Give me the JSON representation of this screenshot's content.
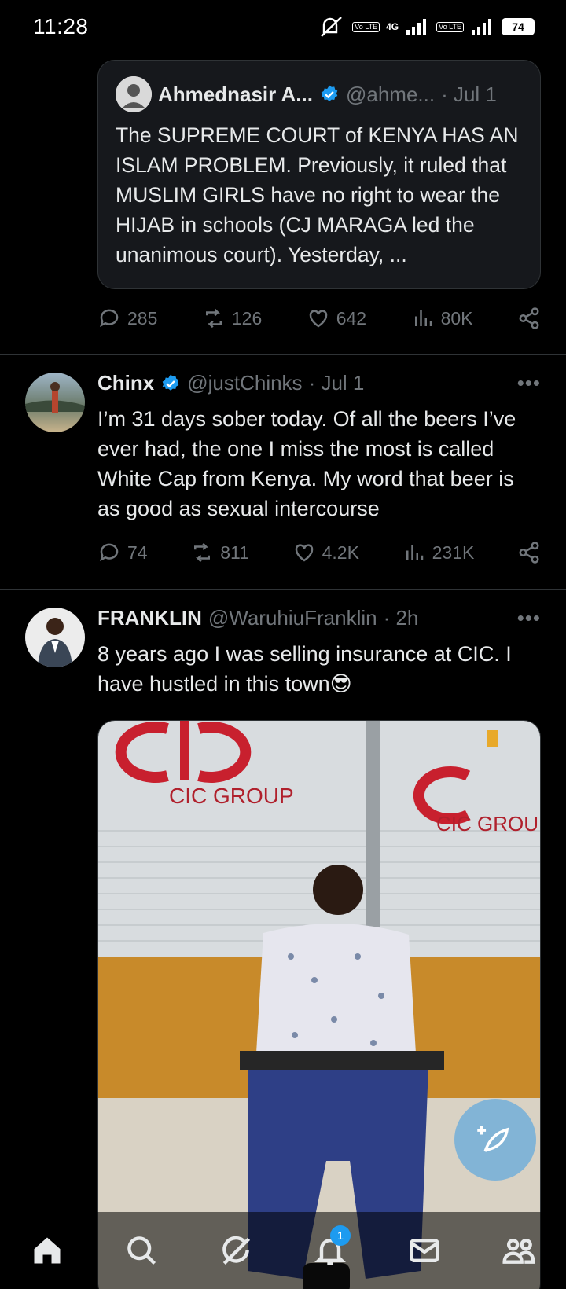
{
  "status_bar": {
    "time": "11:28",
    "net_4g": "4G",
    "volte_1": "Vo LTE",
    "volte_2": "Vo LTE",
    "battery": "74"
  },
  "quote_tweet": {
    "name": "Ahmednasir A...",
    "handle": "@ahme...",
    "date": "· Jul 1",
    "text": "The SUPREME COURT of KENYA HAS AN ISLAM PROBLEM. Previously, it ruled that MUSLIM GIRLS have no right to wear the HIJAB in schools (CJ MARAGA led the unanimous court). Yesterday, ...",
    "stats": {
      "replies": "285",
      "reposts": "126",
      "likes": "642",
      "views": "80K"
    }
  },
  "tweets": [
    {
      "name": "Chinx",
      "handle": "@justChinks",
      "date": "· Jul 1",
      "text": "I’m 31 days sober today. Of all the beers I’ve ever had, the one I miss the most is called White Cap from Kenya. My word that beer is as good as sexual intercourse",
      "stats": {
        "replies": "74",
        "reposts": "811",
        "likes": "4.2K",
        "views": "231K"
      }
    },
    {
      "name": "FRANKLIN",
      "handle": "@WaruhiuFranklin",
      "date": "· 2h",
      "text": "8 years ago I was selling insurance at CIC. I have hustled in this town😎",
      "photo_signs": [
        "CIC GROUP",
        "CIC GROUP"
      ]
    }
  ],
  "more_label": "•••",
  "nav": {
    "notifications_badge": "1"
  },
  "colors": {
    "accent": "#1d9bf0",
    "muted": "#71767b",
    "bg": "#000000"
  }
}
